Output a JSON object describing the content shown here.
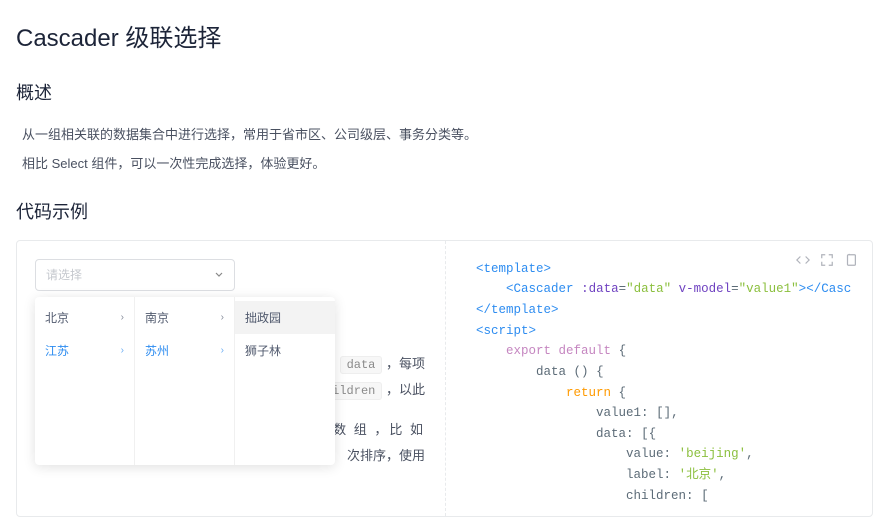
{
  "page": {
    "title": "Cascader 级联选择"
  },
  "overview": {
    "heading": "概述",
    "p1": "从一组相关联的数据集合中进行选择，常用于省市区、公司级层、事务分类等。",
    "p2": "相比 Select 组件，可以一次性完成选择，体验更好。"
  },
  "examples": {
    "heading": "代码示例"
  },
  "cascader": {
    "placeholder": "请选择",
    "col1": [
      {
        "label": "北京",
        "hasChildren": true,
        "active": false
      },
      {
        "label": "江苏",
        "hasChildren": true,
        "active": true
      }
    ],
    "col2": [
      {
        "label": "南京",
        "hasChildren": true,
        "active": false
      },
      {
        "label": "苏州",
        "hasChildren": true,
        "active": true
      }
    ],
    "col3": [
      {
        "label": "拙政园",
        "hasChildren": false,
        "hovered": true
      },
      {
        "label": "狮子林",
        "hasChildren": false,
        "hovered": false
      }
    ]
  },
  "description_fragments": {
    "line1_tag": "data",
    "line1_tail": " ，每项",
    "line2_tag": "ildren",
    "line2_tail": " ，以此",
    "line3": "数 组 ，比 如",
    "line4": "次排序，使用"
  },
  "actions": {
    "code_icon": "code-icon",
    "fullscreen_icon": "fullscreen-icon",
    "copy_icon": "copy-icon"
  },
  "code": {
    "l1_open": "<",
    "l1_tag": "template",
    "l1_close": ">",
    "l2_indent": "    ",
    "l2_open": "<",
    "l2_tag": "Cascader",
    "l2_sp": " ",
    "l2_attr1": ":data",
    "l2_eq1": "=",
    "l2_val1": "\"data\"",
    "l2_sp2": " ",
    "l2_attr2": "v-model",
    "l2_eq2": "=",
    "l2_val2": "\"value1\"",
    "l2_close1": ">",
    "l2_open2": "</",
    "l2_tag2": "Casc",
    "l3_open": "</",
    "l3_tag": "template",
    "l3_close": ">",
    "l4_open": "<",
    "l4_tag": "script",
    "l4_close": ">",
    "l5_indent": "    ",
    "l5_kw": "export",
    "l5_sp": " ",
    "l5_kw2": "default",
    "l5_sp2": " ",
    "l5_brace": "{",
    "l6_indent": "        ",
    "l6_fn": "data ",
    "l6_paren": "()",
    "l6_sp": " ",
    "l6_brace": "{",
    "l7_indent": "            ",
    "l7_kw": "return",
    "l7_sp": " ",
    "l7_brace": "{",
    "l8_indent": "                ",
    "l8_key": "value1:",
    "l8_sp": " ",
    "l8_val": "[],",
    "l9_indent": "                ",
    "l9_key": "data:",
    "l9_sp": " ",
    "l9_val": "[{",
    "l10_indent": "                    ",
    "l10_key": "value:",
    "l10_sp": " ",
    "l10_val": "'beijing'",
    "l10_comma": ",",
    "l11_indent": "                    ",
    "l11_key": "label:",
    "l11_sp": " ",
    "l11_val": "'北京'",
    "l11_comma": ",",
    "l12_indent": "                    ",
    "l12_key": "children:",
    "l12_sp": " ",
    "l12_val": "["
  }
}
